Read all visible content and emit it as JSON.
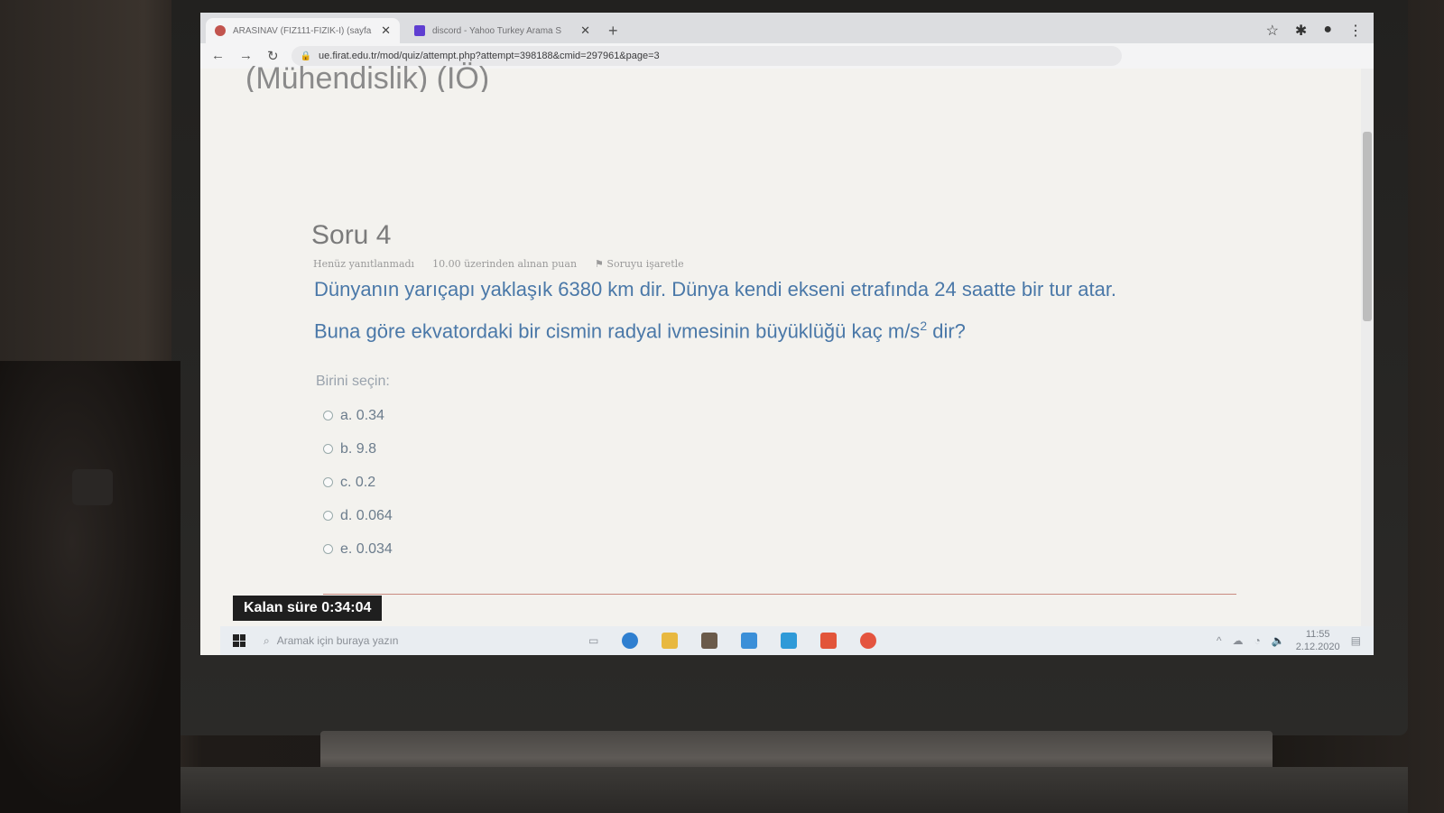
{
  "browser": {
    "tabs": [
      {
        "title": "ARASINAV (FİZ111-FİZİK-I) (sayfa",
        "active": true
      },
      {
        "title": "discord - Yahoo Turkey Arama S",
        "active": false
      }
    ],
    "new_tab": "+",
    "url": "ue.firat.edu.tr/mod/quiz/attempt.php?attempt=398188&cmid=297961&page=3"
  },
  "page": {
    "heading_cut": "(Mühendislik) (IÖ)",
    "question_number": "Soru 4",
    "meta": {
      "status": "Henüz yanıtlanmadı",
      "points": "10.00 üzerinden alınan puan",
      "flag": "Soruyu işaretle"
    },
    "question_line1": "Dünyanın yarıçapı yaklaşık 6380 km dir. Dünya kendi ekseni etrafında 24 saatte bir tur atar.",
    "question_line2_pre": "Buna göre ekvatordaki bir cismin radyal ivmesinin büyüklüğü kaç m/s",
    "question_sup": "2",
    "question_line2_post": " dir?",
    "choose_label": "Birini seçin:",
    "options": [
      "a. 0.34",
      "b. 9.8",
      "c. 0.2",
      "d. 0.064",
      "e. 0.034"
    ],
    "timer_label": "Kalan süre ",
    "timer_value": "0:34:04"
  },
  "taskbar": {
    "search_placeholder": "Aramak için buraya yazın",
    "time": "11:55",
    "date": "2.12.2020"
  }
}
